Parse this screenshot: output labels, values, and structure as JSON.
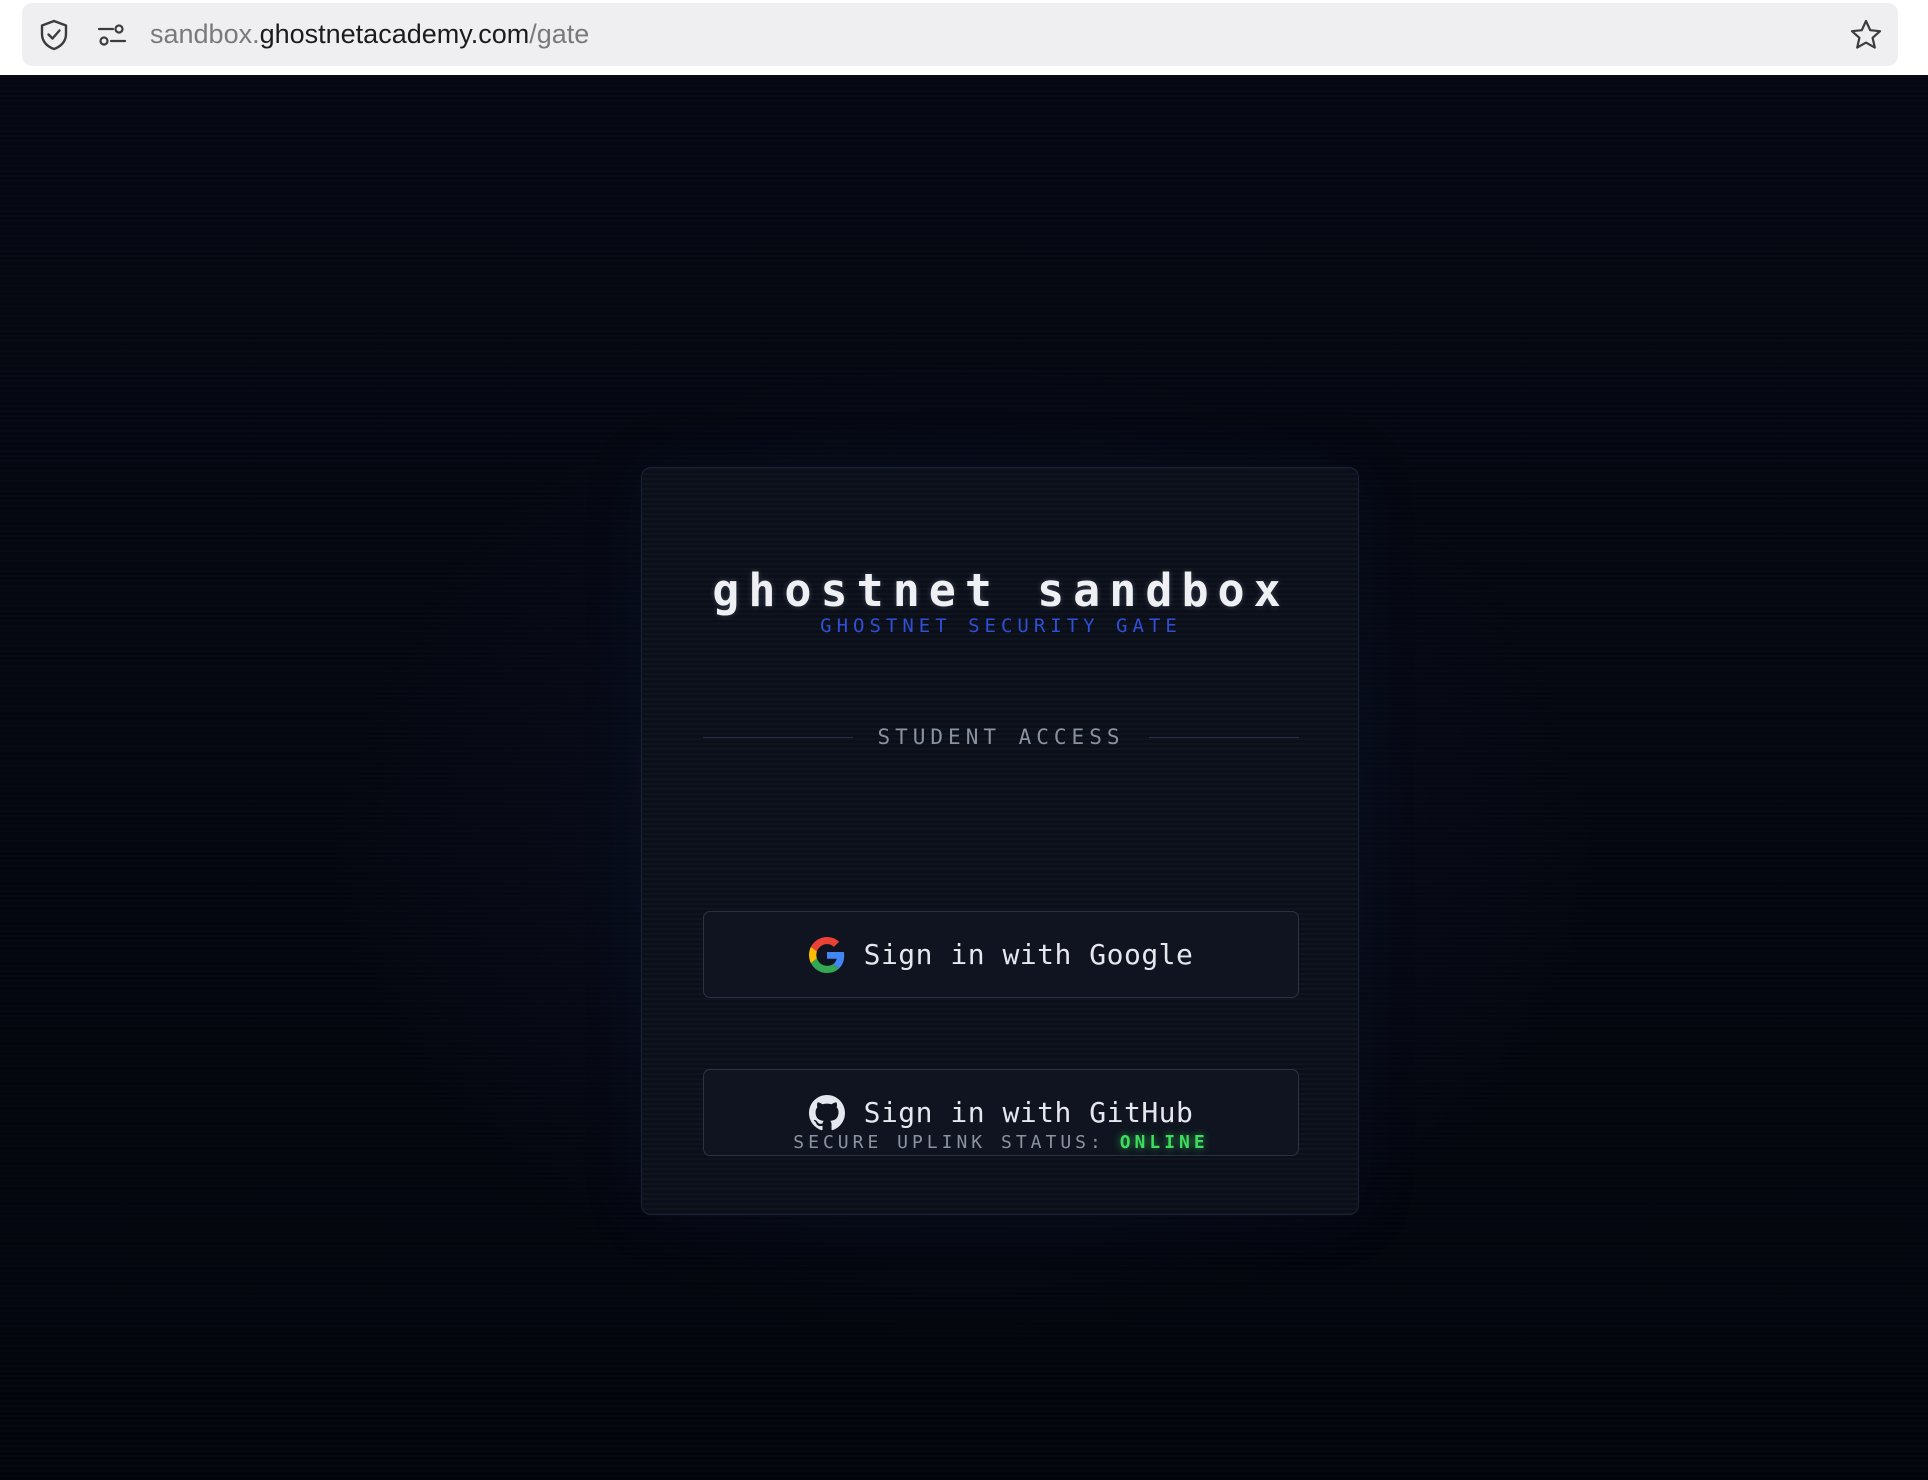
{
  "browser": {
    "url_prefix": "sandbox.",
    "url_domain": "ghostnetacademy.com",
    "url_path": "/gate",
    "icons": [
      "shield-icon",
      "tune-icon",
      "star-icon"
    ]
  },
  "login": {
    "title": "ghostnet sandbox",
    "subtitle": "GHOSTNET SECURITY GATE",
    "section_label": "STUDENT ACCESS",
    "google_button": "Sign in with Google",
    "github_button": "Sign in with GitHub",
    "status_label": "SECURE UPLINK STATUS:",
    "status_value": "ONLINE"
  },
  "colors": {
    "background": "#03050c",
    "card": "#0b0f19",
    "accent_blue": "#2f4fd6",
    "status_green": "#3ddc5c"
  }
}
